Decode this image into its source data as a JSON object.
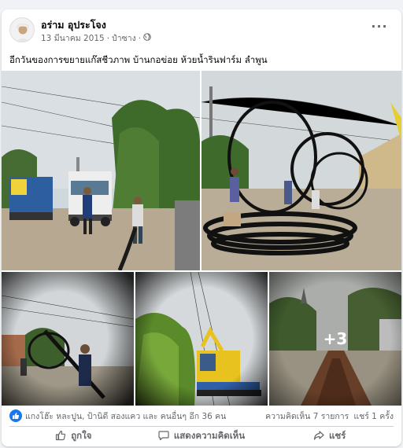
{
  "post": {
    "author": "อร่าม อุประโจง",
    "date": "13 มีนาคม 2015",
    "audience": "ปำซาง",
    "caption": "อีกวันของการขยายแก๊สชีวภาพ  บ้านกอข่อย   ห้วยน้ำรินฟาร์ม   ลำพูน",
    "more_label": "···",
    "extra_photos": "+3"
  },
  "stats": {
    "reactions_text": "แกงโฮ๊ะ หละปูน, ป้านิดี สองแคว และ คนอื่นๆ อีก 36 คน",
    "comments": "ความคิดเห็น 7 รายการ",
    "shares": "แชร์ 1 ครั้ง"
  },
  "actions": {
    "like": "ถูกใจ",
    "comment": "แสดงความคิดเห็น",
    "share": "แชร์"
  },
  "icons": {
    "avatar": "user-avatar",
    "globe": "globe-icon",
    "more": "more-options-icon",
    "like_badge": "like-reaction-icon",
    "like": "thumbs-up-icon",
    "comment": "comment-icon",
    "share": "share-icon"
  },
  "colors": {
    "accent": "#1877f2",
    "secondary_text": "#65676b"
  }
}
